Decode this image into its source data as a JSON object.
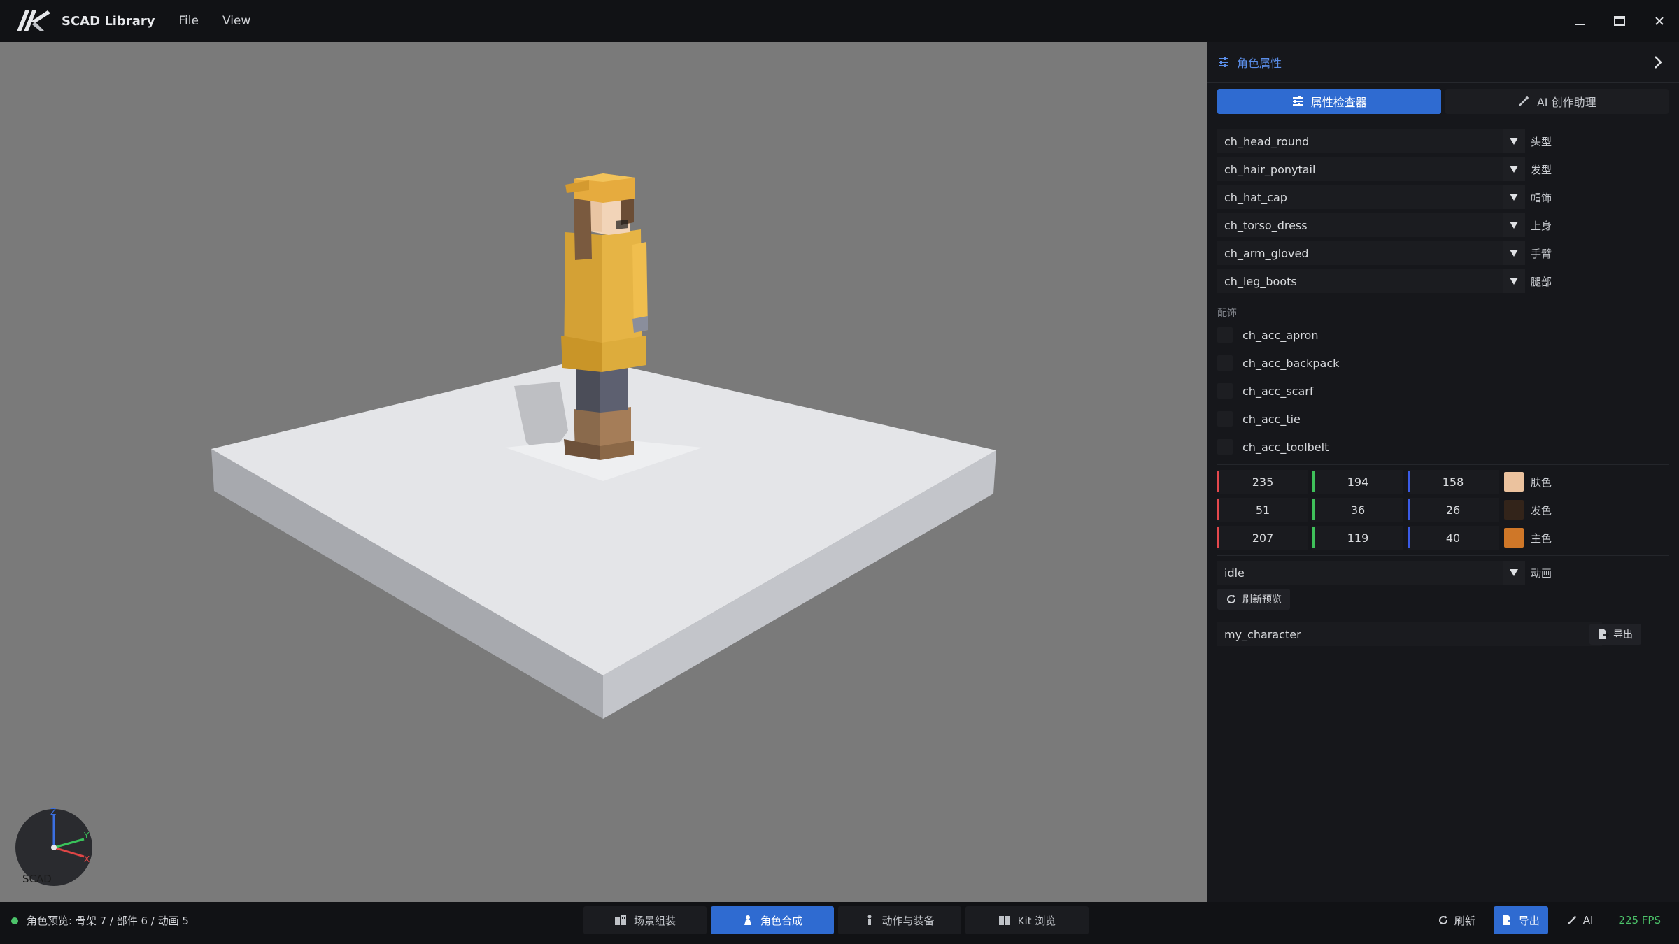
{
  "app": {
    "title": "SCAD Library"
  },
  "menu": [
    {
      "label": "File"
    },
    {
      "label": "View"
    }
  ],
  "viewport": {
    "gizmo_label": "SCAD"
  },
  "panel": {
    "header_title": "角色属性",
    "tabs": [
      {
        "label": "属性检查器",
        "active": true
      },
      {
        "label": "AI 创作助理",
        "active": false
      }
    ],
    "parts": [
      {
        "value": "ch_head_round",
        "label": "头型"
      },
      {
        "value": "ch_hair_ponytail",
        "label": "发型"
      },
      {
        "value": "ch_hat_cap",
        "label": "帽饰"
      },
      {
        "value": "ch_torso_dress",
        "label": "上身"
      },
      {
        "value": "ch_arm_gloved",
        "label": "手臂"
      },
      {
        "value": "ch_leg_boots",
        "label": "腿部"
      }
    ],
    "accessories_label": "配饰",
    "accessories": [
      {
        "label": "ch_acc_apron"
      },
      {
        "label": "ch_acc_backpack"
      },
      {
        "label": "ch_acc_scarf"
      },
      {
        "label": "ch_acc_tie"
      },
      {
        "label": "ch_acc_toolbelt"
      }
    ],
    "colors": [
      {
        "r": "235",
        "g": "194",
        "b": "158",
        "label": "肤色",
        "hex": "#ebc29e"
      },
      {
        "r": "51",
        "g": "36",
        "b": "26",
        "label": "发色",
        "hex": "#33241a"
      },
      {
        "r": "207",
        "g": "119",
        "b": "40",
        "label": "主色",
        "hex": "#cf7728"
      }
    ],
    "animation": {
      "value": "idle",
      "label": "动画"
    },
    "refresh_preview_label": "刷新预览",
    "export_name": "my_character",
    "export_label": "导出"
  },
  "status": {
    "text": "角色预览: 骨架 7 / 部件 6 / 动画 5",
    "tabs": [
      {
        "label": "场景组装",
        "active": false
      },
      {
        "label": "角色合成",
        "active": true
      },
      {
        "label": "动作与装备",
        "active": false
      },
      {
        "label": "Kit 浏览",
        "active": false
      }
    ],
    "refresh_label": "刷新",
    "export_label": "导出",
    "ai_label": "AI",
    "fps": "225 FPS"
  },
  "theme": {
    "accent": "#2f6bd1",
    "viewport_bg": "#7a7a7a",
    "fps_color": "#4cc36a"
  }
}
